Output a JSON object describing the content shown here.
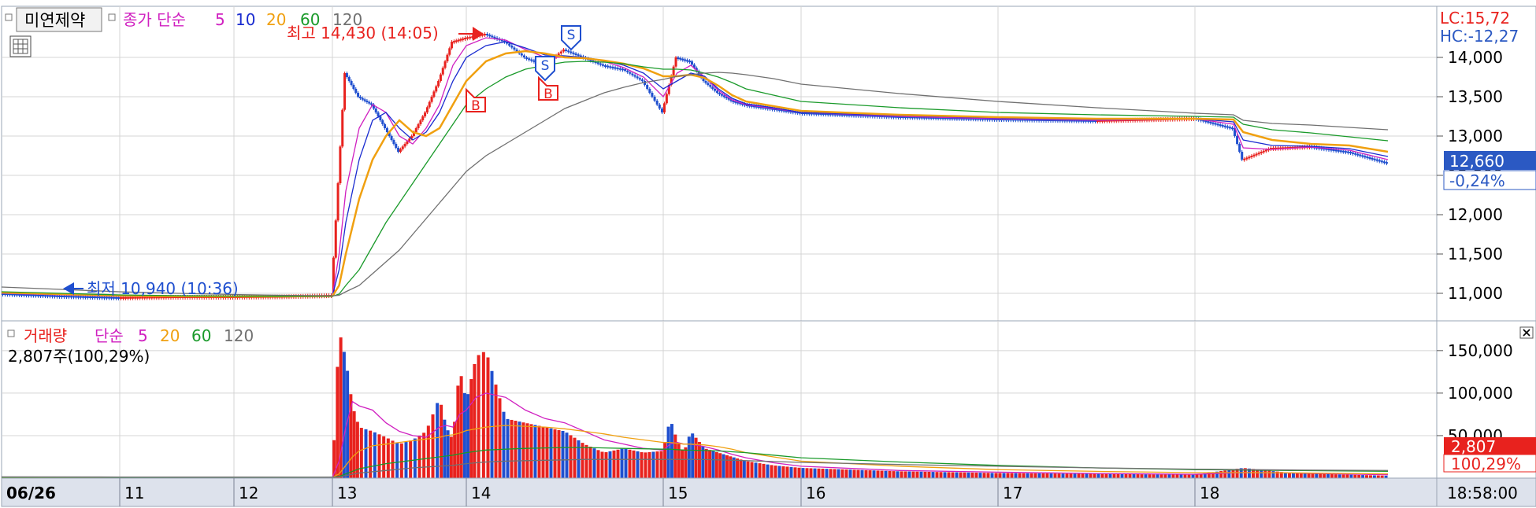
{
  "stock": {
    "name": "미연제약",
    "price_legend": {
      "label": "종가 단순",
      "periods": [
        "5",
        "10",
        "20",
        "60",
        "120"
      ]
    },
    "volume_legend": {
      "label": "거래량",
      "ma_label": "단순",
      "periods": [
        "5",
        "20",
        "60",
        "120"
      ]
    },
    "volume_info": "2,807주(100,29%)",
    "lc": "LC:15,72",
    "hc": "HC:-12,27"
  },
  "markers": {
    "high": "최고 14,430 (14:05)",
    "low": "최저 10,940 (10:36)",
    "buy": "B",
    "sell": "S"
  },
  "current": {
    "price": "12,660",
    "change": "-0,24%",
    "volume": "2,807",
    "volume_pct": "100,29%"
  },
  "time_readout": "18:58:00",
  "colors": {
    "up": "#e8221e",
    "down": "#1f4fcf",
    "ma5": "#d020c0",
    "ma10": "#1a2cd0",
    "ma20": "#f0a010",
    "ma60": "#1a9a2a",
    "ma120": "#707070",
    "grid": "#d4d4d4",
    "axis_bg": "#dde2ec",
    "badge": "#2b59c3"
  },
  "chart_data": [
    {
      "type": "line",
      "series_kind": "intraday price (candles) with simple moving averages",
      "x_day_labels": [
        "06/26",
        "11",
        "12",
        "13",
        "14",
        "15",
        "16",
        "17",
        "18"
      ],
      "y_ticks": [
        11000,
        11500,
        12000,
        12500,
        13000,
        13500,
        14000
      ],
      "ylim": [
        10650,
        14650
      ],
      "x": [
        0,
        0.5,
        1,
        1.5,
        2,
        2.5,
        3,
        3.05,
        3.1,
        3.2,
        3.3,
        3.4,
        3.5,
        3.6,
        3.7,
        3.8,
        3.9,
        4,
        4.1,
        4.2,
        4.3,
        4.4,
        4.5,
        4.6,
        4.7,
        4.8,
        4.9,
        5,
        5.1,
        5.2,
        5.3,
        5.4,
        5.5,
        5.6,
        5.8,
        6,
        6.5,
        7,
        7.5,
        8,
        8.2,
        8.25,
        8.4,
        8.6,
        8.8,
        9
      ],
      "close": [
        11000,
        10970,
        10950,
        10960,
        10960,
        10965,
        10980,
        12400,
        13800,
        13500,
        13400,
        13100,
        12800,
        13000,
        13300,
        13700,
        14200,
        14250,
        14300,
        14200,
        14000,
        13900,
        14100,
        14000,
        13900,
        13850,
        13700,
        13300,
        14000,
        13950,
        13700,
        13550,
        13450,
        13400,
        13350,
        13300,
        13250,
        13220,
        13200,
        13230,
        13100,
        12700,
        12850,
        12870,
        12800,
        12660
      ],
      "series": [
        {
          "name": "5",
          "values": [
            11000,
            10980,
            10960,
            10960,
            10960,
            10963,
            10970,
            11500,
            12300,
            13100,
            13400,
            13300,
            13000,
            12900,
            13100,
            13400,
            13900,
            14150,
            14250,
            14220,
            14100,
            14000,
            14000,
            14000,
            13950,
            13870,
            13750,
            13500,
            13800,
            13900,
            13750,
            13580,
            13460,
            13400,
            13350,
            13300,
            13250,
            13220,
            13200,
            13220,
            13150,
            12850,
            12830,
            12860,
            12820,
            12700
          ]
        },
        {
          "name": "10",
          "values": [
            11005,
            10985,
            10965,
            10960,
            10960,
            10962,
            10968,
            11300,
            11900,
            12700,
            13200,
            13300,
            13100,
            12950,
            13050,
            13300,
            13700,
            14000,
            14150,
            14200,
            14120,
            14030,
            14020,
            14000,
            13960,
            13900,
            13800,
            13600,
            13700,
            13800,
            13760,
            13600,
            13480,
            13410,
            13360,
            13300,
            13260,
            13230,
            13210,
            13220,
            13180,
            12950,
            12880,
            12870,
            12840,
            12740
          ]
        },
        {
          "name": "20",
          "values": [
            11010,
            10990,
            10970,
            10962,
            10960,
            10961,
            10965,
            11100,
            11500,
            12200,
            12700,
            13000,
            13200,
            13050,
            13000,
            13100,
            13400,
            13700,
            13950,
            14050,
            14080,
            14050,
            14000,
            13990,
            13960,
            13920,
            13860,
            13760,
            13760,
            13780,
            13740,
            13640,
            13520,
            13440,
            13380,
            13320,
            13270,
            13240,
            13220,
            13220,
            13210,
            13050,
            12950,
            12900,
            12880,
            12800
          ]
        },
        {
          "name": "60",
          "values": [
            11020,
            11000,
            10980,
            10970,
            10965,
            10963,
            10963,
            10990,
            11100,
            11300,
            11600,
            11900,
            12150,
            12400,
            12650,
            12900,
            13150,
            13400,
            13600,
            13750,
            13850,
            13900,
            13940,
            13950,
            13940,
            13920,
            13880,
            13850,
            13850,
            13840,
            13800,
            13750,
            13680,
            13600,
            13520,
            13440,
            13360,
            13300,
            13270,
            13250,
            13240,
            13150,
            13080,
            13040,
            12990,
            12940
          ]
        },
        {
          "name": "120",
          "values": [
            11080,
            11050,
            11020,
            11000,
            10985,
            10975,
            10968,
            10975,
            11020,
            11100,
            11250,
            11400,
            11550,
            11750,
            11950,
            12150,
            12350,
            12550,
            12750,
            12900,
            13050,
            13200,
            13350,
            13450,
            13550,
            13620,
            13680,
            13720,
            13760,
            13780,
            13800,
            13810,
            13800,
            13780,
            13730,
            13660,
            13540,
            13440,
            13360,
            13290,
            13270,
            13200,
            13160,
            13140,
            13110,
            13080
          ]
        }
      ]
    },
    {
      "type": "bar",
      "series_kind": "volume with simple moving averages",
      "y_ticks": [
        50000,
        100000,
        150000
      ],
      "ylim": [
        0,
        185000
      ],
      "x": [
        0,
        1,
        2,
        3,
        3.05,
        3.1,
        3.15,
        3.2,
        3.3,
        3.4,
        3.5,
        3.6,
        3.7,
        3.8,
        3.85,
        3.9,
        3.95,
        4,
        4.05,
        4.1,
        4.2,
        4.3,
        4.4,
        4.5,
        4.6,
        4.7,
        4.8,
        4.9,
        5,
        5.05,
        5.1,
        5.15,
        5.2,
        5.3,
        5.4,
        5.5,
        5.6,
        5.8,
        6,
        6.5,
        7,
        7.5,
        8,
        8.25,
        8.5,
        9
      ],
      "values": [
        800,
        600,
        700,
        1500,
        174000,
        140000,
        85000,
        60000,
        55000,
        48000,
        40000,
        45000,
        55000,
        95000,
        60000,
        45000,
        130000,
        90000,
        143000,
        150000,
        70000,
        65000,
        60000,
        55000,
        40000,
        30000,
        35000,
        30000,
        32000,
        70000,
        45000,
        30000,
        55000,
        35000,
        30000,
        25000,
        20000,
        15000,
        12000,
        8000,
        6000,
        5000,
        4000,
        12000,
        6000,
        2807
      ],
      "series": [
        {
          "name": "5",
          "values": [
            900,
            750,
            700,
            800,
            20000,
            60000,
            90000,
            85000,
            80000,
            65000,
            55000,
            50000,
            48000,
            60000,
            62000,
            60000,
            75000,
            80000,
            95000,
            100000,
            95000,
            80000,
            70000,
            65000,
            55000,
            45000,
            40000,
            35000,
            33000,
            40000,
            42000,
            40000,
            40000,
            37000,
            33000,
            28000,
            24000,
            18000,
            14000,
            9000,
            7000,
            5500,
            4500,
            6500,
            6000,
            4000
          ]
        },
        {
          "name": "20",
          "values": [
            1000,
            900,
            800,
            800,
            5000,
            15000,
            25000,
            32000,
            38000,
            40000,
            42000,
            44000,
            46000,
            48000,
            50000,
            51000,
            53000,
            56000,
            58000,
            60000,
            62000,
            61000,
            60000,
            58000,
            55000,
            52000,
            48000,
            45000,
            42000,
            42000,
            41000,
            40000,
            40000,
            39000,
            37000,
            34000,
            30000,
            25000,
            20000,
            14000,
            10000,
            8000,
            6500,
            6500,
            6200,
            5000
          ]
        },
        {
          "name": "60",
          "values": [
            1200,
            1100,
            1000,
            950,
            2000,
            5000,
            8000,
            11000,
            14000,
            17000,
            19000,
            21000,
            23000,
            25000,
            26000,
            27000,
            28500,
            30000,
            31500,
            33000,
            34000,
            35000,
            35500,
            36000,
            36000,
            35500,
            35000,
            34500,
            34000,
            34000,
            33500,
            33000,
            32800,
            32500,
            32000,
            31000,
            30000,
            27000,
            24000,
            19000,
            15000,
            12000,
            10000,
            9500,
            9000,
            8000
          ]
        },
        {
          "name": "120",
          "values": [
            1500,
            1300,
            1200,
            1100,
            1500,
            3000,
            4500,
            6000,
            7500,
            9000,
            10500,
            12000,
            13000,
            14000,
            14500,
            15000,
            16000,
            17000,
            18000,
            19000,
            20000,
            20500,
            21000,
            21500,
            22000,
            22000,
            22000,
            22000,
            22000,
            22000,
            22000,
            22000,
            22000,
            21800,
            21500,
            21000,
            20500,
            19500,
            18500,
            16000,
            14000,
            12000,
            10500,
            10000,
            9500,
            9000
          ]
        }
      ]
    }
  ]
}
